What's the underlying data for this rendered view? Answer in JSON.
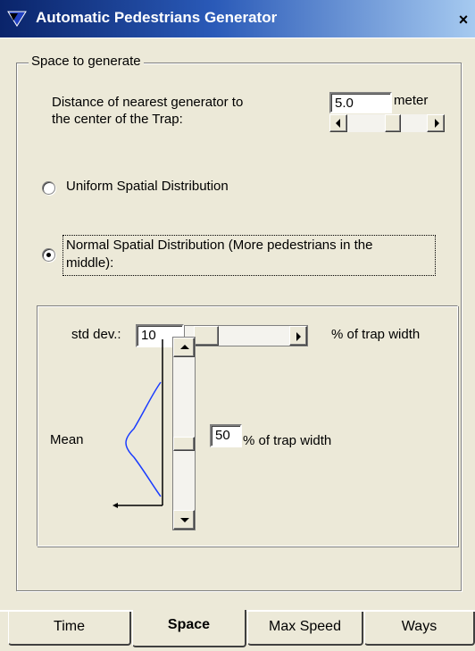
{
  "window": {
    "title": "Automatic Pedestrians Generator",
    "close_glyph": "×",
    "title_gradient_start": "#0a246a",
    "title_gradient_end": "#a6caf0"
  },
  "group": {
    "label": "Space to generate"
  },
  "distance": {
    "label_line1": "Distance of nearest generator to",
    "label_line2": "the center of the Trap:",
    "value": "5.0",
    "unit": "meter"
  },
  "radios": [
    {
      "label": "Uniform Spatial Distribution",
      "checked": false
    },
    {
      "label_line1": "Normal Spatial Distribution (More pedestrians in the",
      "label_line2": "middle):",
      "checked": true
    }
  ],
  "std_dev": {
    "label": "std dev.:",
    "value": "10",
    "unit": "% of trap width"
  },
  "mean": {
    "label": "Mean",
    "value": "50",
    "unit": "% of trap width"
  },
  "tabs": [
    {
      "label": "Time",
      "active": false
    },
    {
      "label": "Space",
      "active": true
    },
    {
      "label": "Max Speed",
      "active": false
    },
    {
      "label": "Ways",
      "active": false
    }
  ]
}
